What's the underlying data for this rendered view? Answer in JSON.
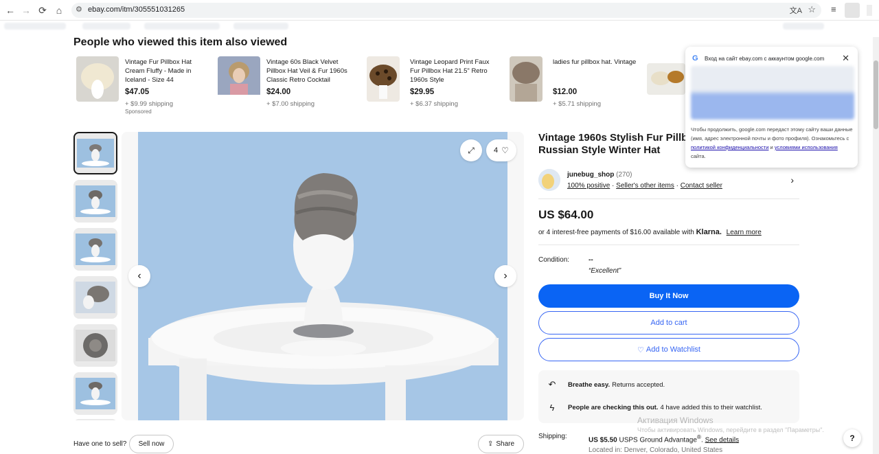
{
  "browser": {
    "url": "ebay.com/itm/305551031265"
  },
  "also_viewed": {
    "title": "People who viewed this item also viewed",
    "items": [
      {
        "title": "Vintage Fur Pillbox Hat Cream Fluffy - Made in Iceland - Size 44",
        "price": "$47.05",
        "shipping": "+ $9.99 shipping",
        "sponsored": "Sponsored"
      },
      {
        "title": "Vintage 60s Black Velvet Pillbox Hat Veil & Fur 1960s Classic Retro Cocktail",
        "price": "$24.00",
        "shipping": "+ $7.00 shipping",
        "sponsored": ""
      },
      {
        "title": "Vintage Leopard Print Faux Fur Pillbox Hat 21.5\" Retro 1960s Style",
        "price": "$29.95",
        "shipping": "+ $6.37 shipping",
        "sponsored": ""
      },
      {
        "title": "ladies fur pillbox hat. Vintage",
        "price": "$12.00",
        "shipping": "+ $5.71 shipping",
        "sponsored": ""
      }
    ]
  },
  "gallery": {
    "watch_count": "4",
    "have_one": "Have one to sell?",
    "sell_now": "Sell now",
    "share": "Share"
  },
  "product": {
    "title_line1": "Vintage 1960s Stylish Fur Pillb",
    "title_line2": "Russian Style Winter Hat",
    "seller_name": "junebug_shop",
    "seller_count": "(270)",
    "positive": "100% positive",
    "other_items": "Seller's other items",
    "contact": "Contact seller",
    "price": "US $64.00",
    "klarna_text": "or 4 interest-free payments of $16.00 available with",
    "klarna_brand": "Klarna.",
    "learn_more": "Learn more",
    "condition_label": "Condition:",
    "condition_value": "--",
    "condition_desc": "“Excellent”",
    "buy_now": "Buy It Now",
    "add_to_cart": "Add to cart",
    "add_to_watchlist": "Add to Watchlist",
    "breathe_bold": "Breathe easy.",
    "breathe_text": "Returns accepted.",
    "checking_bold": "People are checking this out.",
    "checking_text": "4 have added this to their watchlist.",
    "shipping_label": "Shipping:",
    "shipping_price": "US $5.50",
    "shipping_method": "USPS Ground Advantage",
    "shipping_reg": "®",
    "see_details": "See details",
    "location": "Located in: Denver, Colorado, United States"
  },
  "google_popup": {
    "title": "Вход на сайт ebay.com с аккаунтом google.com",
    "text_1": "Чтобы продолжить, google.com передаст этому сайту ваши данные (имя, адрес электронной почты и фото профиля). Ознакомьтесь с",
    "privacy_link": "политикой конфиденциальности",
    "and": "и",
    "terms_link": "условиями использования",
    "text_end": "сайта."
  },
  "windows": {
    "activate_title": "Активация Windows",
    "activate_sub": "Чтобы активировать Windows, перейдите в раздел \"Параметры\"."
  },
  "help": "?"
}
